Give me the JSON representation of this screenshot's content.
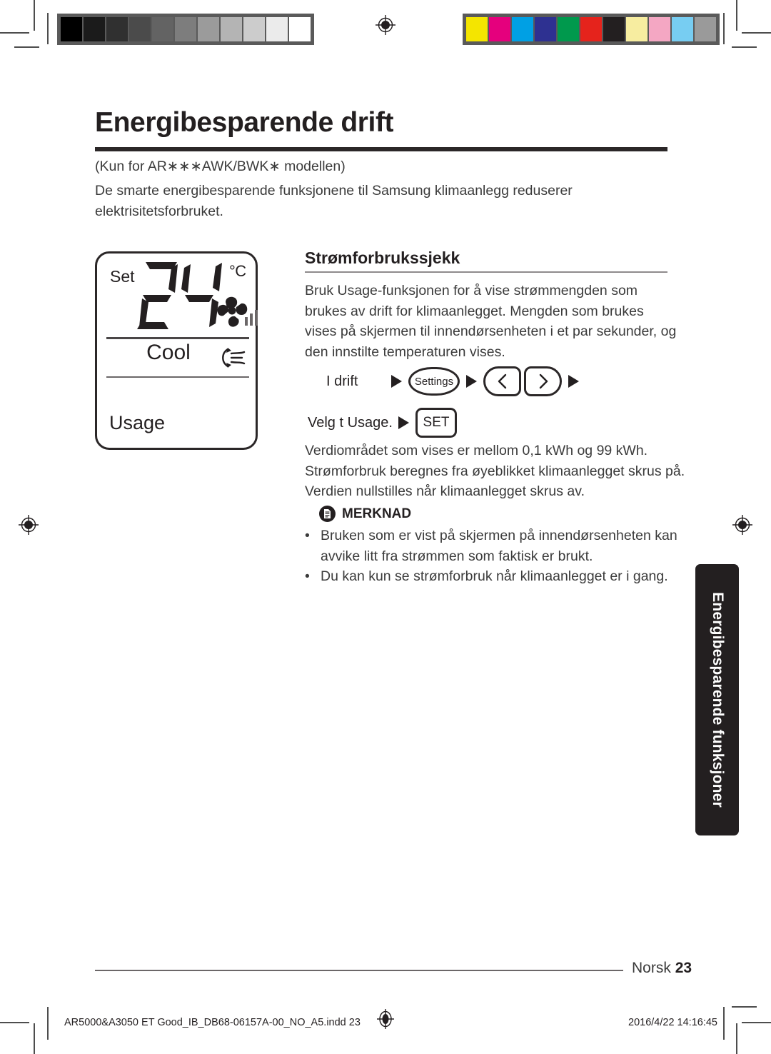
{
  "document": {
    "title": "Energibesparende drift",
    "model_note": "(Kun for AR∗∗∗AWK/BWK∗ modellen)",
    "intro": "De smarte energibesparende funksjonene til Samsung klimaanlegg reduserer elektrisitetsforbruket."
  },
  "lcd": {
    "set_label": "Set",
    "temperature": "24",
    "unit": "°C",
    "mode": "Cool",
    "usage_label": "Usage",
    "fan_icon": "fan-icon",
    "fan_bars_icon": "signal-bars-icon",
    "swing_icon": "airflow-swing-icon"
  },
  "section": {
    "heading": "Strømforbrukssjekk",
    "body": "Bruk Usage-funksjonen for å vise strømmengden som brukes av drift for klimaanlegget. Mengden som brukes vises på skjermen til innendørsenheten i et par sekunder, og den innstilte temperaturen vises.",
    "body2": "Verdiområdet som vises er mellom 0,1 kWh og 99 kWh. Strømforbruk beregnes fra øyeblikket klimaanlegget skrus på. Verdien nullstilles når klimaanlegget skrus av."
  },
  "steps": {
    "row1_label": "I drift",
    "settings_button": "Settings",
    "left_button": "chevron-left-icon",
    "right_button": "chevron-right-icon",
    "row2_label": "Velg t Usage.",
    "set_button": "SET"
  },
  "note": {
    "icon": "note-document-icon",
    "title": "MERKNAD",
    "bullet_marker": "•",
    "items": [
      "Bruken som er vist på skjermen på innendørsenheten kan avvike litt fra strømmen som faktisk er brukt.",
      "Du kan kun se strømforbruk når klimaanlegget er i gang."
    ]
  },
  "side_tab": {
    "label": "Energibesparende funksjoner"
  },
  "footer": {
    "language": "Norsk",
    "page_number": "23",
    "file_name": "AR5000&A3050 ET Good_IB_DB68-06157A-00_NO_A5.indd   23",
    "timestamp": "2016/4/22   14:16:45"
  },
  "calibration": {
    "gray_swatches": [
      "#000000",
      "#1b1b1b",
      "#303030",
      "#4b4b4b",
      "#636363",
      "#7d7d7d",
      "#9b9b9b",
      "#b4b4b4",
      "#cccccc",
      "#ebebeb",
      "#ffffff"
    ],
    "color_swatches": [
      "#f4e500",
      "#e5007d",
      "#00a0e4",
      "#2e3191",
      "#00994d",
      "#e5231c",
      "#231f20",
      "#f7eda0",
      "#f4a7c3",
      "#77cdf2",
      "#9a9a9a"
    ]
  }
}
